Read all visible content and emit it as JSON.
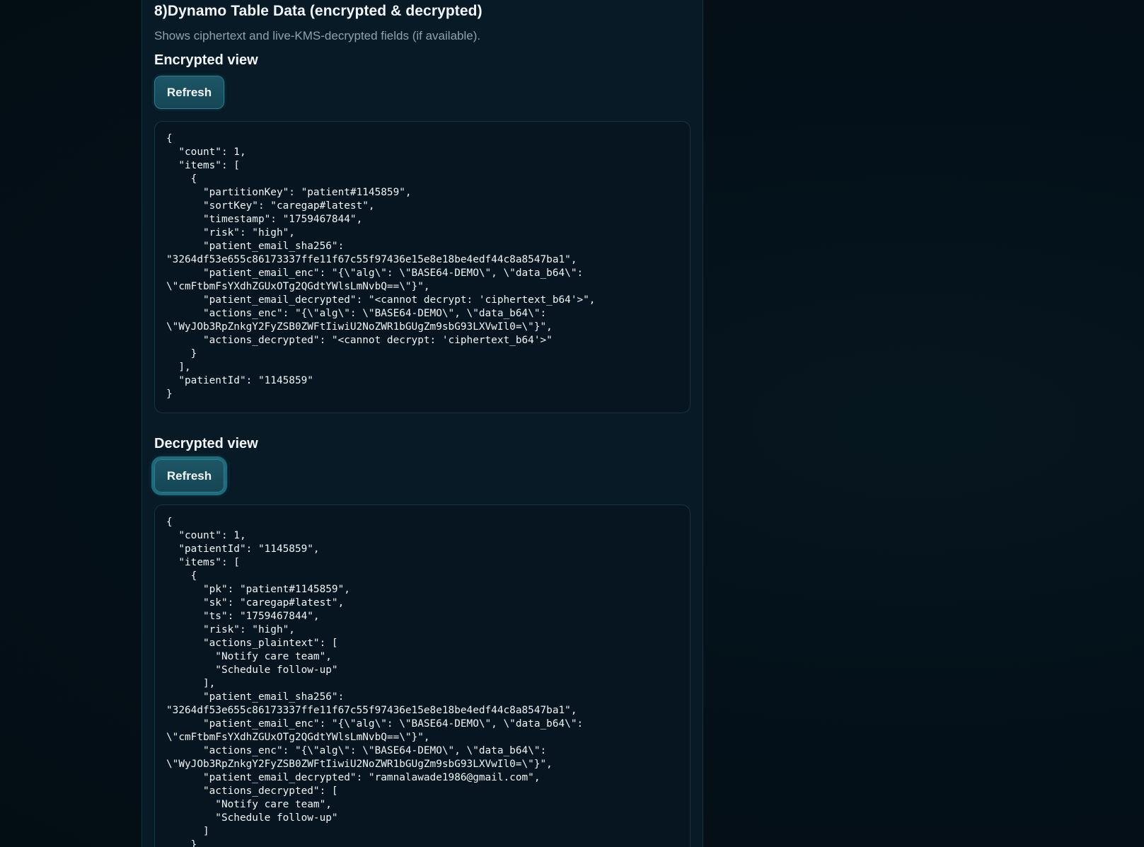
{
  "section": {
    "title": "8)Dynamo Table Data (encrypted & decrypted)",
    "description": "Shows ciphertext and live-KMS-decrypted fields (if available)."
  },
  "encrypted_view": {
    "title": "Encrypted view",
    "refresh_label": "Refresh",
    "json_text": "{\n  \"count\": 1,\n  \"items\": [\n    {\n      \"partitionKey\": \"patient#1145859\",\n      \"sortKey\": \"caregap#latest\",\n      \"timestamp\": \"1759467844\",\n      \"risk\": \"high\",\n      \"patient_email_sha256\":\n\"3264df53e655c86173337ffe11f67c55f97436e15e8e18be4edf44c8a8547ba1\",\n      \"patient_email_enc\": \"{\\\"alg\\\": \\\"BASE64-DEMO\\\", \\\"data_b64\\\":\n\\\"cmFtbmFsYXdhZGUxOTg2QGdtYWlsLmNvbQ==\\\"}\",\n      \"patient_email_decrypted\": \"<cannot decrypt: 'ciphertext_b64'>\",\n      \"actions_enc\": \"{\\\"alg\\\": \\\"BASE64-DEMO\\\", \\\"data_b64\\\":\n\\\"WyJOb3RpZnkgY2FyZSB0ZWFtIiwiU2NoZWR1bGUgZm9sbG93LXVwIl0=\\\"}\",\n      \"actions_decrypted\": \"<cannot decrypt: 'ciphertext_b64'>\"\n    }\n  ],\n  \"patientId\": \"1145859\"\n}"
  },
  "decrypted_view": {
    "title": "Decrypted view",
    "refresh_label": "Refresh",
    "json_text": "{\n  \"count\": 1,\n  \"patientId\": \"1145859\",\n  \"items\": [\n    {\n      \"pk\": \"patient#1145859\",\n      \"sk\": \"caregap#latest\",\n      \"ts\": \"1759467844\",\n      \"risk\": \"high\",\n      \"actions_plaintext\": [\n        \"Notify care team\",\n        \"Schedule follow-up\"\n      ],\n      \"patient_email_sha256\":\n\"3264df53e655c86173337ffe11f67c55f97436e15e8e18be4edf44c8a8547ba1\",\n      \"patient_email_enc\": \"{\\\"alg\\\": \\\"BASE64-DEMO\\\", \\\"data_b64\\\":\n\\\"cmFtbmFsYXdhZGUxOTg2QGdtYWlsLmNvbQ==\\\"}\",\n      \"actions_enc\": \"{\\\"alg\\\": \\\"BASE64-DEMO\\\", \\\"data_b64\\\":\n\\\"WyJOb3RpZnkgY2FyZSB0ZWFtIiwiU2NoZWR1bGUgZm9sbG93LXVwIl0=\\\"}\",\n      \"patient_email_decrypted\": \"ramnalawade1986@gmail.com\",\n      \"actions_decrypted\": [\n        \"Notify care team\",\n        \"Schedule follow-up\"\n      ]\n    }"
  },
  "colors": {
    "page_background": "#04111a",
    "panel_background": "#071a25",
    "button_background": "#1d5665",
    "button_border": "#2f7d8e",
    "muted_text": "#8fa2ad"
  }
}
